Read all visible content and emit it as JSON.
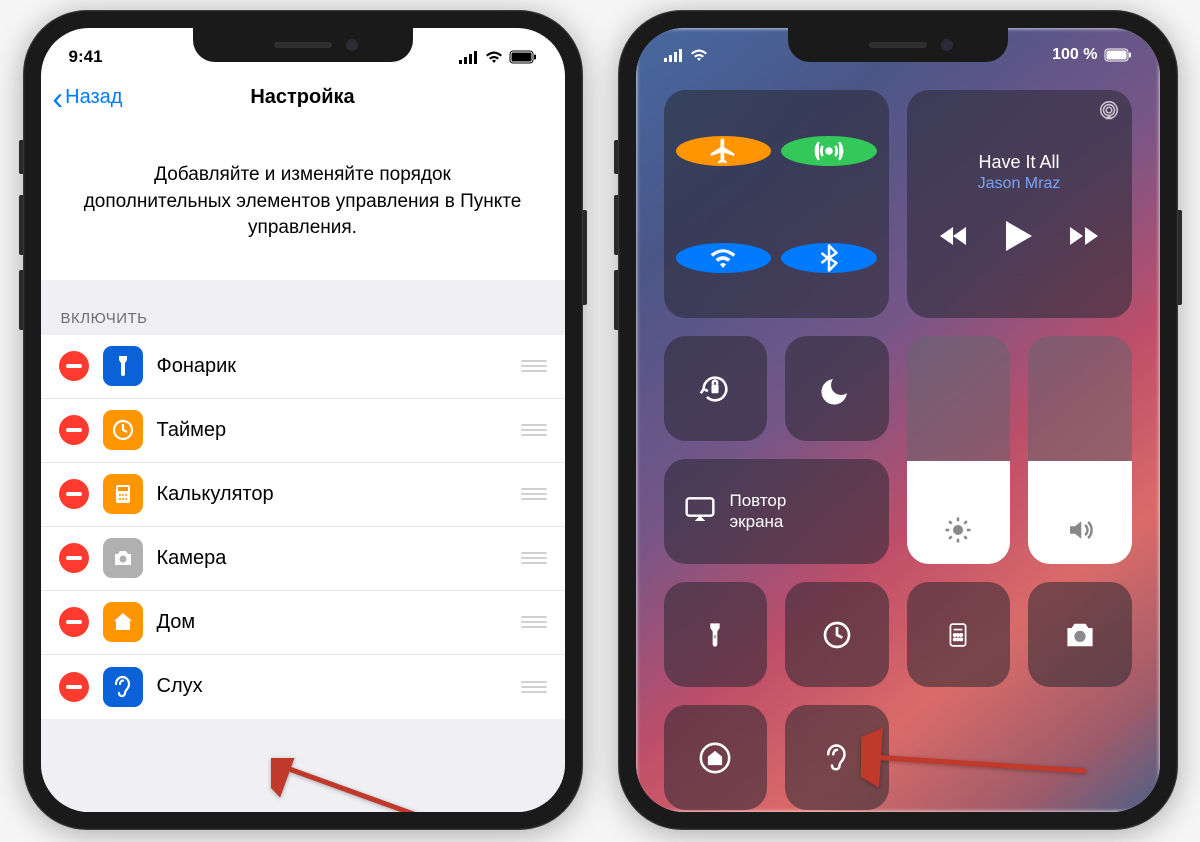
{
  "phone1": {
    "status": {
      "time": "9:41"
    },
    "nav": {
      "back": "Назад",
      "title": "Настройка"
    },
    "description": "Добавляйте и изменяйте порядок дополнительных элементов управления в Пункте управления.",
    "section_include": "ВКЛЮЧИТЬ",
    "items": [
      {
        "label": "Фонарик",
        "icon": "flashlight",
        "color": "#0a61d8"
      },
      {
        "label": "Таймер",
        "icon": "timer",
        "color": "#ff9500"
      },
      {
        "label": "Калькулятор",
        "icon": "calculator",
        "color": "#ff9500"
      },
      {
        "label": "Камера",
        "icon": "camera",
        "color": "#b0b0b0"
      },
      {
        "label": "Дом",
        "icon": "home",
        "color": "#ff9500"
      },
      {
        "label": "Слух",
        "icon": "ear",
        "color": "#0a61d8"
      }
    ]
  },
  "phone2": {
    "status": {
      "battery": "100 %"
    },
    "music": {
      "title": "Have It All",
      "artist": "Jason Mraz"
    },
    "mirror": {
      "label": "Повтор\nэкрана"
    }
  }
}
